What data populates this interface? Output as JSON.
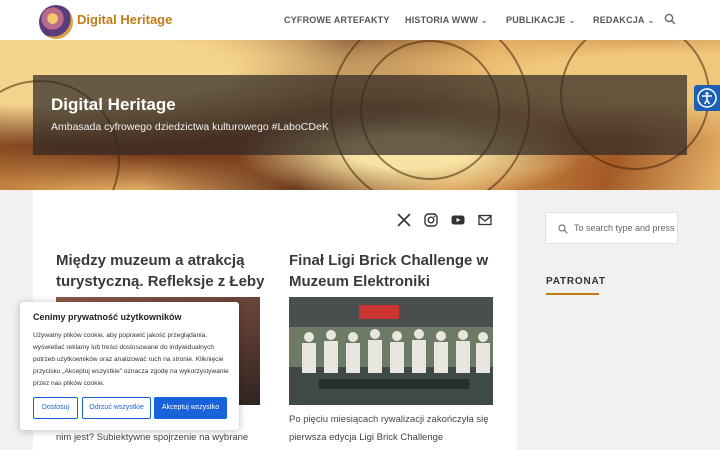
{
  "header": {
    "brand": "Digital Heritage",
    "nav": [
      {
        "label": "CYFROWE ARTEFAKTY",
        "has_dropdown": false
      },
      {
        "label": "HISTORIA WWW",
        "has_dropdown": true
      },
      {
        "label": "PUBLIKACJE",
        "has_dropdown": true
      },
      {
        "label": "REDAKCJA",
        "has_dropdown": true
      }
    ],
    "search_icon": "search-icon",
    "dropdown_glyph": "⌄"
  },
  "hero": {
    "title": "Digital Heritage",
    "subtitle": "Ambasada cyfrowego dziedzictwa kulturowego #LaboCDeK"
  },
  "accessibility_icon": "accessibility-icon",
  "social": [
    "x-icon",
    "instagram-icon",
    "youtube-icon",
    "mail-icon"
  ],
  "posts": [
    {
      "title_line1": "Między muzeum a atrakcją",
      "title_line2": "turystyczną. Refleksje z Łeby",
      "excerpt_line1": "nim jest? Subiektywne spojrzenie na wybrane atrakcje"
    },
    {
      "title_line1": "Finał Ligi Brick Challenge w",
      "title_line2": "Muzeum Elektroniki",
      "excerpt_line1": "Po pięciu miesiącach rywalizacji zakończyła się",
      "excerpt_line2": "pierwsza edycja Ligi Brick Challenge organizowanej"
    }
  ],
  "sidebar": {
    "search_placeholder": "To search type and press",
    "heading": "PATRONAT"
  },
  "cookie": {
    "title": "Cenimy prywatność użytkowników",
    "text": "Używamy plików cookie, aby poprawić jakość przeglądania, wyświetlać reklamy lub treści dostosowane do indywidualnych potrzeb użytkowników oraz analizować ruch na stronie. Kliknięcie przycisku „Akceptuj wszystkie” oznacza zgodę na wykorzystywanie przez nas plików cookie.",
    "btn_customize": "Dostosuj",
    "btn_reject": "Odrzuć wszystkie",
    "btn_accept": "Akceptuj wszystko"
  },
  "colors": {
    "brand": "#c07d16",
    "accent_blue": "#1863dc",
    "a11y_blue": "#1e5fb6"
  }
}
